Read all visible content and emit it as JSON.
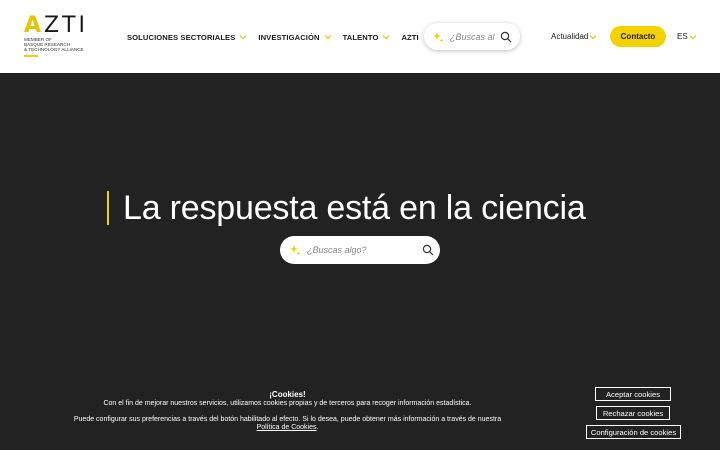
{
  "header": {
    "logo": {
      "wordmark_accent": "A",
      "wordmark_rest": "ZTI",
      "sub_lines": [
        "MEMBER OF",
        "BASQUE RESEARCH",
        "& TECHNOLOGY ALLIANCE"
      ]
    },
    "nav": [
      {
        "label": "SOLUCIONES SECTORIALES",
        "icon": "chevron-down-icon"
      },
      {
        "label": "INVESTIGACIÓN",
        "icon": "chevron-down-icon"
      },
      {
        "label": "TALENTO",
        "icon": "chevron-down-icon"
      },
      {
        "label": "AZTI",
        "icon": "chevron-down-icon"
      }
    ],
    "search": {
      "placeholder": "¿Buscas al",
      "icon": "search-icon",
      "ai_icon": "sparkle-icon"
    },
    "actualidad": "Actualidad",
    "contacto": "Contacto",
    "lang": "ES"
  },
  "hero": {
    "title": "La respuesta está en la ciencia",
    "search_placeholder": "¿Buscas algo?"
  },
  "cookies": {
    "title": "¡Cookies!",
    "text1": "Con el fin de mejorar nuestros servicios, utilizamos cookies propias y de terceros para recoger información estadística.",
    "text2": "Puede configurar sus preferencias a través del botón habilitado al efecto. Si lo desea, puede obtener más información a través de nuestra",
    "link": "Política de Cookies",
    "link_suffix": ".",
    "accept": "Aceptar cookies",
    "reject": "Rechazar cookies",
    "config": "Configuración de cookies"
  },
  "colors": {
    "accent": "#f4d200",
    "background": "#222222",
    "header": "#ffffff"
  }
}
